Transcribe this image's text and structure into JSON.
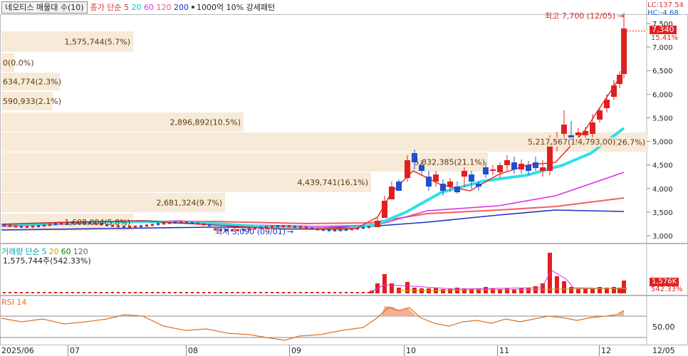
{
  "header": {
    "stock_title": "네오티스 매물대 수(10)",
    "ma_label": "종가 단순",
    "ma_periods": [
      "5",
      "20",
      "60",
      "120",
      "200"
    ],
    "ma_colors": [
      "#e03030",
      "#00c8d8",
      "#e030e0",
      "#f06060",
      "#2030c0"
    ],
    "pattern_label": "1000억 10% 강세패턴"
  },
  "right_info": {
    "lc": "LC:137.54",
    "hc": "HC:-4.68"
  },
  "price_axis": {
    "ticks": [
      "7,500",
      "7,000",
      "6,500",
      "6,000",
      "5,500",
      "5,000",
      "4,500",
      "4,000",
      "3,500",
      "3,000"
    ],
    "current_price": "7,340",
    "current_pct": "15.41%"
  },
  "annotations": {
    "high": "최고 7,700 (12/05)",
    "low": "최저 3,090 (09/01)"
  },
  "volume_profile": [
    {
      "label": "1,575,744(5.7%)"
    },
    {
      "label": "0(0.0%)"
    },
    {
      "label": "634,774(2.3%)"
    },
    {
      "label": "590,933(2.1%)"
    },
    {
      "label": "2,896,892(10.5%)"
    },
    {
      "label": "7,381,365(26.7%)"
    },
    {
      "label": "5,832,385(21.1%)"
    },
    {
      "label": "4,439,741(16.1%)"
    },
    {
      "label": "2,681,324(9.7%)"
    },
    {
      "label": "1,608,004(5.8%)"
    }
  ],
  "overlay_label": "5,217,567(19.0%)",
  "overlay_label2": "4,793,00)",
  "volume_panel": {
    "title": "거래량",
    "ma_label": "단순",
    "ma_periods": [
      "5",
      "20",
      "60",
      "120"
    ],
    "ma_colors": [
      "#00b0b8",
      "#d0d000",
      "#008000",
      "#404040"
    ],
    "current": "1,575,744주(542.33%)",
    "axis_value": "1,576K",
    "axis_pct": "542.33%"
  },
  "rsi_panel": {
    "title": "RSI 14",
    "axis_value": "50.00"
  },
  "x_axis": {
    "labels": [
      "2025/06",
      "07",
      "08",
      "09",
      "10",
      "11",
      "12",
      "12/05"
    ]
  }
}
